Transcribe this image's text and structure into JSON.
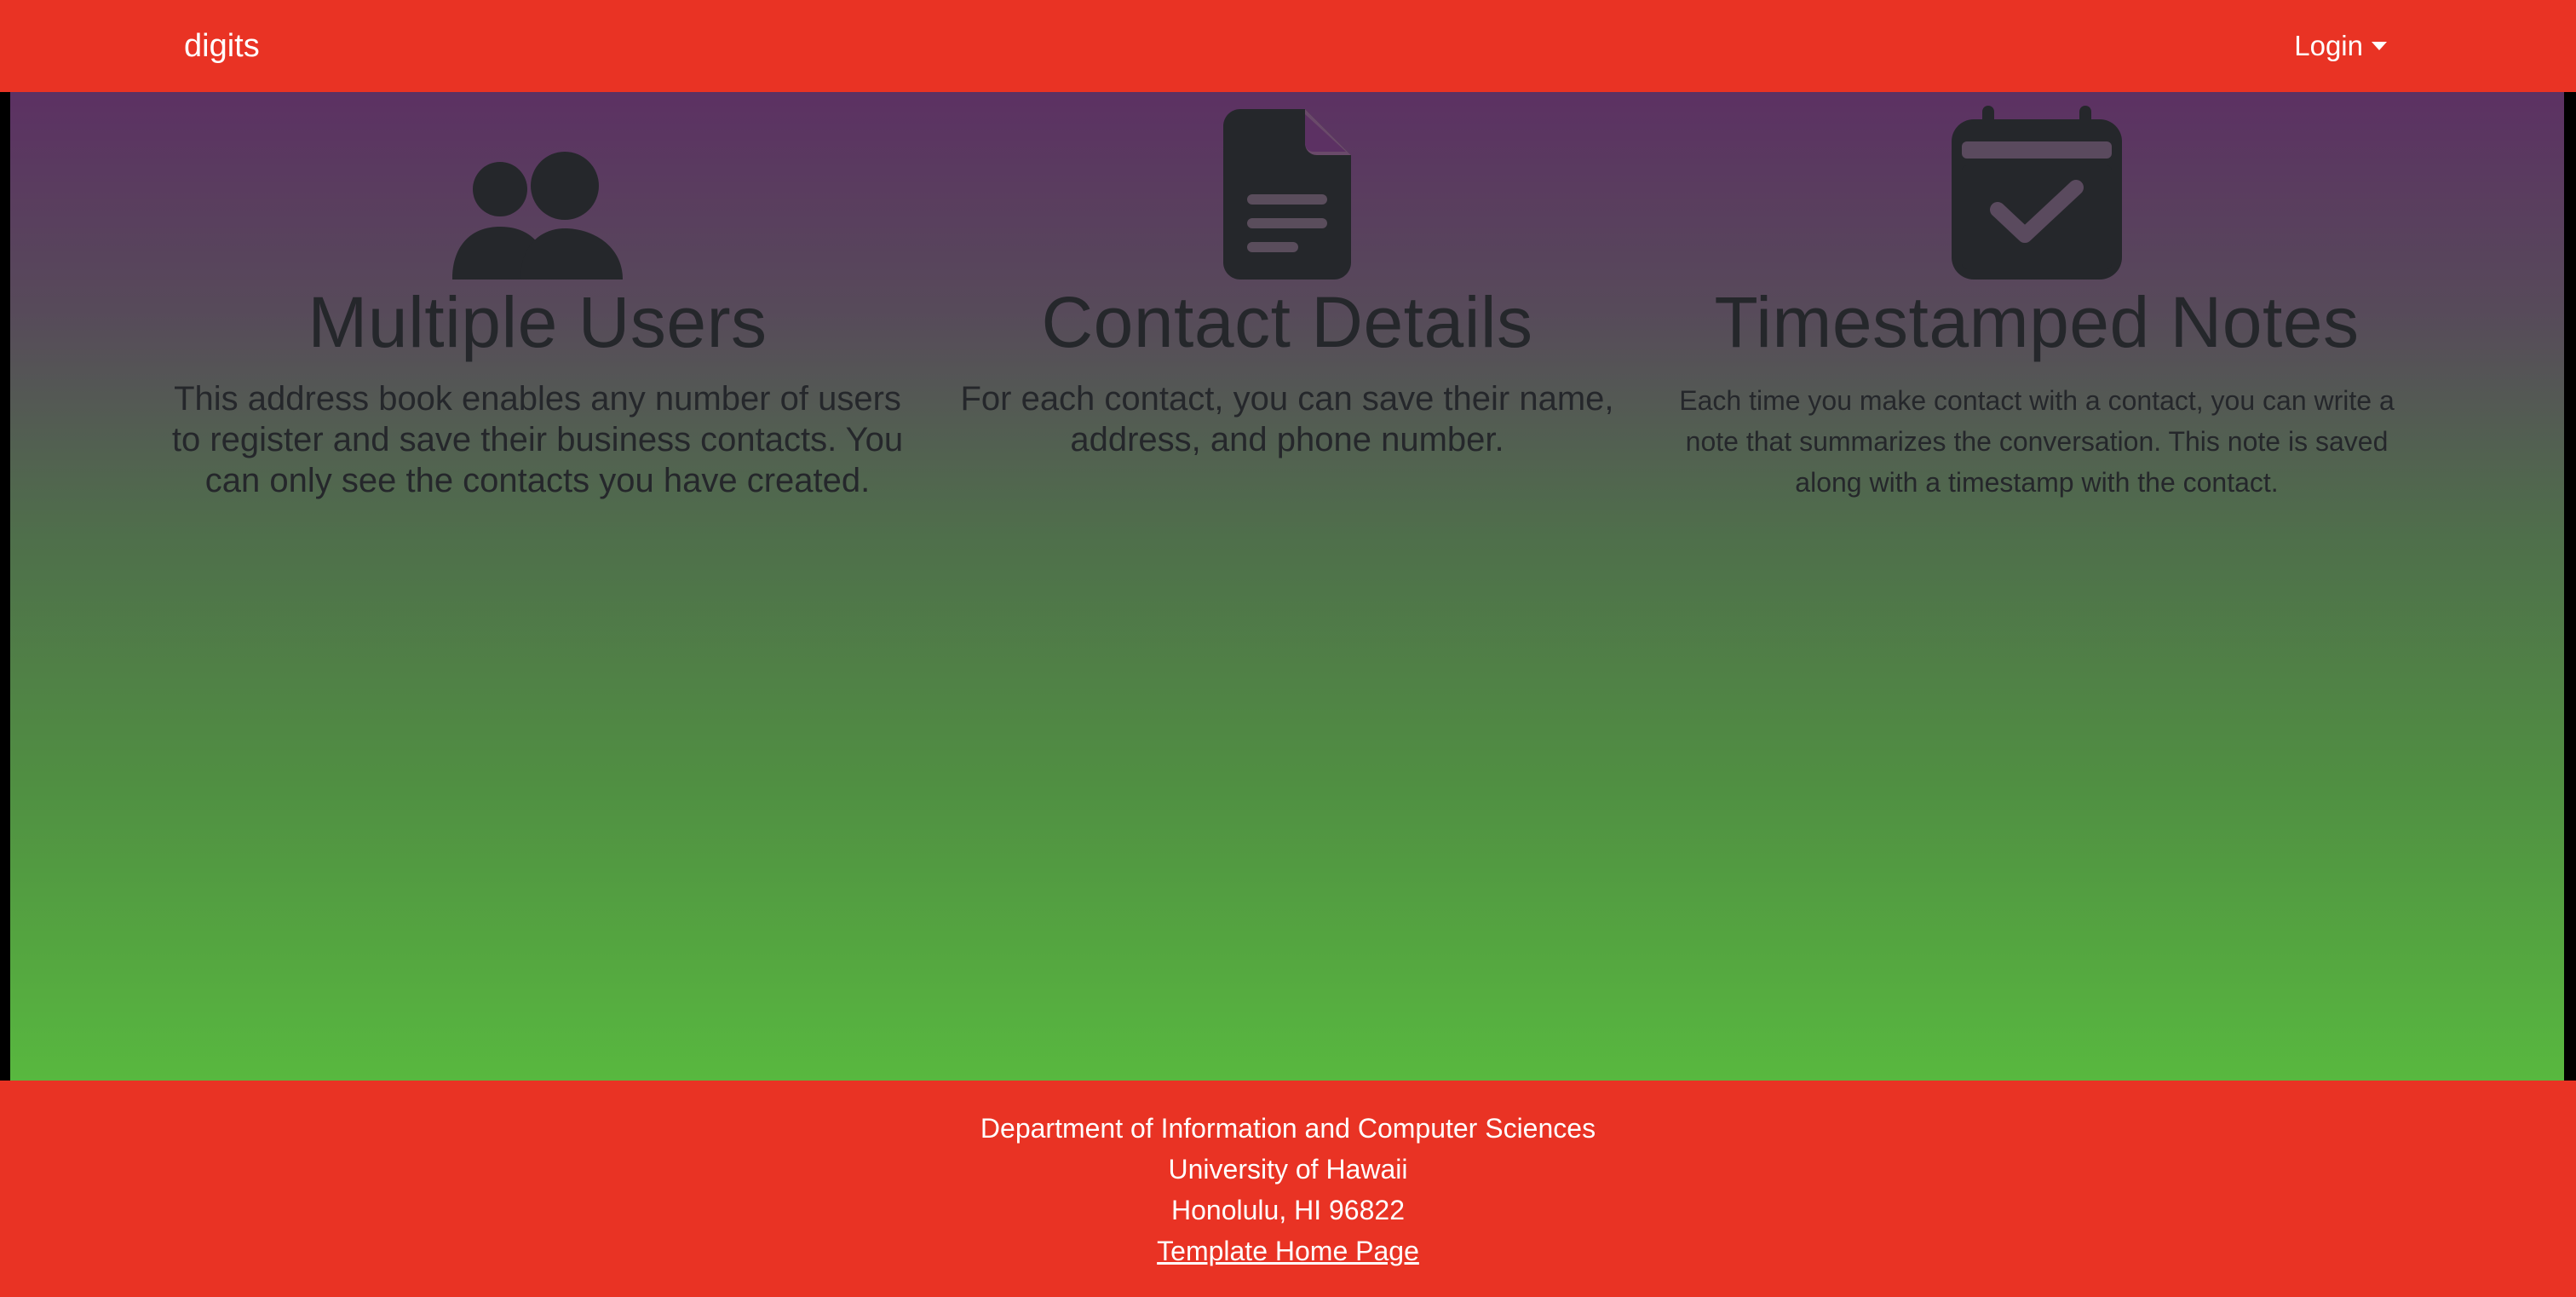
{
  "navbar": {
    "brand": "digits",
    "login_label": "Login"
  },
  "features": [
    {
      "icon": "users-icon",
      "title": "Multiple Users",
      "description": "This address book enables any number of users to register and save their business contacts. You can only see the contacts you have created."
    },
    {
      "icon": "file-lines-icon",
      "title": "Contact Details",
      "description": "For each contact, you can save their name, address, and phone number."
    },
    {
      "icon": "calendar-check-icon",
      "title": "Timestamped Notes",
      "description": "Each time you make contact with a contact, you can write a note that summarizes the conversation. This note is saved along with a timestamp with the contact."
    }
  ],
  "footer": {
    "line1": "Department of Information and Computer Sciences",
    "line2": "University of Hawaii",
    "line3": "Honolulu, HI 96822",
    "link_label": "Template Home Page"
  },
  "colors": {
    "navbar_bg": "#e93324",
    "footer_bg": "#e93324",
    "gradient_top": "#5c3163",
    "gradient_bottom": "#58b83f",
    "icon_text": "#25272b"
  }
}
